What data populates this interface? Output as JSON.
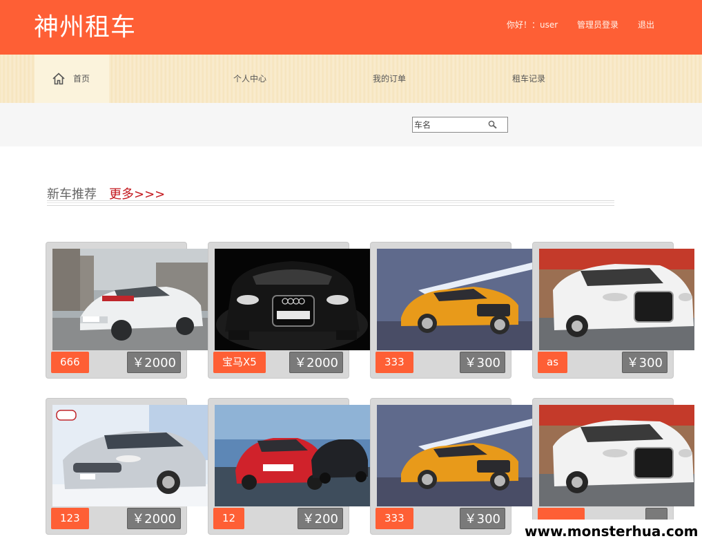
{
  "header": {
    "logo": "神州租车",
    "greeting": "你好！：user",
    "admin_login": "管理员登录",
    "logout": "退出"
  },
  "nav": {
    "home": "首页",
    "personal_center": "个人中心",
    "my_orders": "我的订单",
    "rental_records": "租车记录"
  },
  "search": {
    "placeholder": "车名"
  },
  "section": {
    "title": "新车推荐",
    "more": "更多>>>"
  },
  "cars": [
    {
      "name": "666",
      "price": "￥2000",
      "image": "white-sedan"
    },
    {
      "name": "宝马X5",
      "price": "￥2000",
      "image": "black-audi-tt-front"
    },
    {
      "name": "333",
      "price": "￥300",
      "image": "orange-audi-tt"
    },
    {
      "name": "as",
      "price": "￥300",
      "image": "white-audi-a8"
    },
    {
      "name": "123",
      "price": "￥2000",
      "image": "silver-kia-k5"
    },
    {
      "name": "12",
      "price": "￥200",
      "image": "red-bmw-3-series"
    },
    {
      "name": "333",
      "price": "￥300",
      "image": "orange-audi-tt"
    },
    {
      "name": "",
      "price": "",
      "image": "white-audi-a8"
    }
  ],
  "watermark": "www.monsterhua.com",
  "colors": {
    "header_bg": "#fe5f35",
    "accent_badge": "#fe5f35",
    "price_badge": "#7a7a7a",
    "more_link": "#c3161c"
  }
}
